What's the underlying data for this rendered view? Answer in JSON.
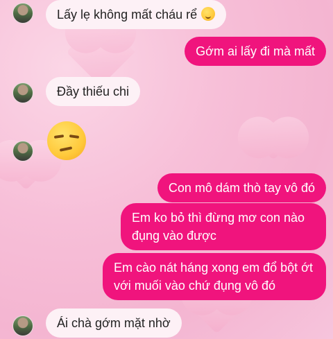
{
  "messages": [
    {
      "side": "in",
      "text": "Lấy lẹ không mất cháu rể"
    },
    {
      "side": "out",
      "text": "Gớm ai lấy đi mà mất"
    },
    {
      "side": "in",
      "text": "Đầy thiếu chi"
    },
    {
      "side": "out",
      "text": "Con mô dám thò tay vô đó"
    },
    {
      "side": "out",
      "text": "Em ko bỏ thì đừng mơ con nào đụng vào được"
    },
    {
      "side": "out",
      "text": "Em cào nát háng xong em đổ bột ớt với muối vào chứ đụng vô đó"
    },
    {
      "side": "in",
      "text": "Ái chà gớm mặt nhờ"
    }
  ],
  "emoji": {
    "inline": "woozy-face",
    "large": "unamused-face"
  },
  "colors": {
    "outgoing": "#f0147d",
    "incoming": "#fdf1f6"
  }
}
